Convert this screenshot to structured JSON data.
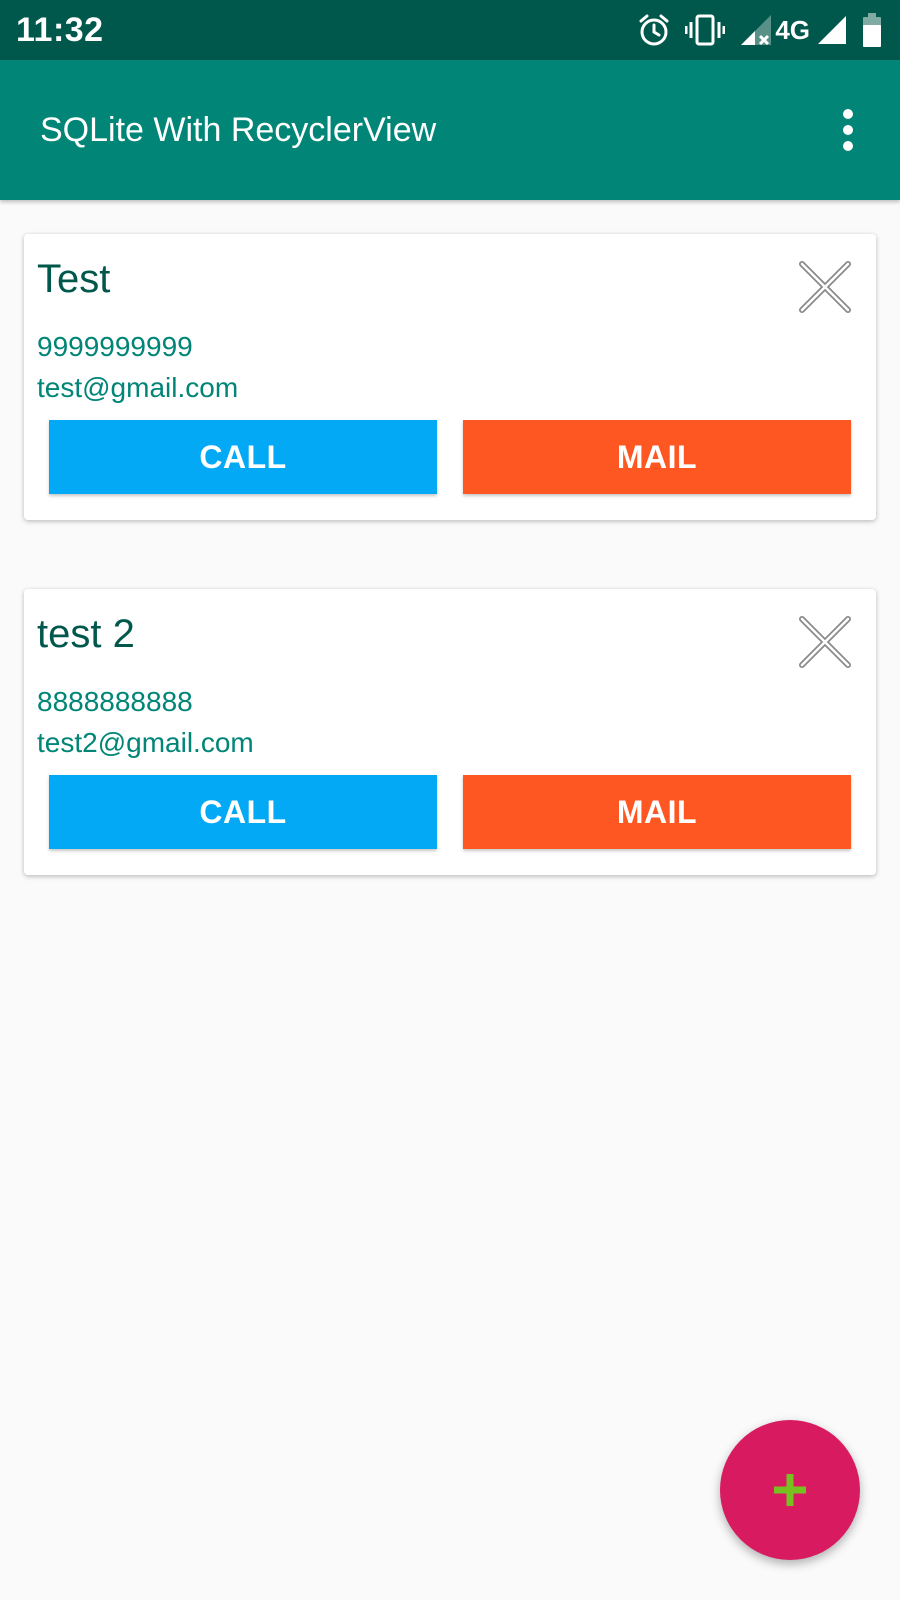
{
  "status_bar": {
    "time": "11:32",
    "network": "4G",
    "icons": [
      "alarm-icon",
      "vibrate-icon",
      "signal-no-data-icon",
      "signal-icon",
      "battery-icon"
    ]
  },
  "app_bar": {
    "title": "SQLite With RecyclerView",
    "menu_icon": "more-vertical-icon"
  },
  "contacts": [
    {
      "name": "Test",
      "phone": "9999999999",
      "email": "test@gmail.com",
      "call_label": "CALL",
      "mail_label": "MAIL"
    },
    {
      "name": "test 2",
      "phone": "8888888888",
      "email": "test2@gmail.com",
      "call_label": "CALL",
      "mail_label": "MAIL"
    }
  ],
  "fab": {
    "icon": "plus-icon"
  },
  "colors": {
    "status_bar": "#00574b",
    "app_bar": "#008577",
    "call_button": "#03a9f4",
    "mail_button": "#ff5722",
    "fab": "#d81b60",
    "fab_icon": "#76c11f"
  }
}
